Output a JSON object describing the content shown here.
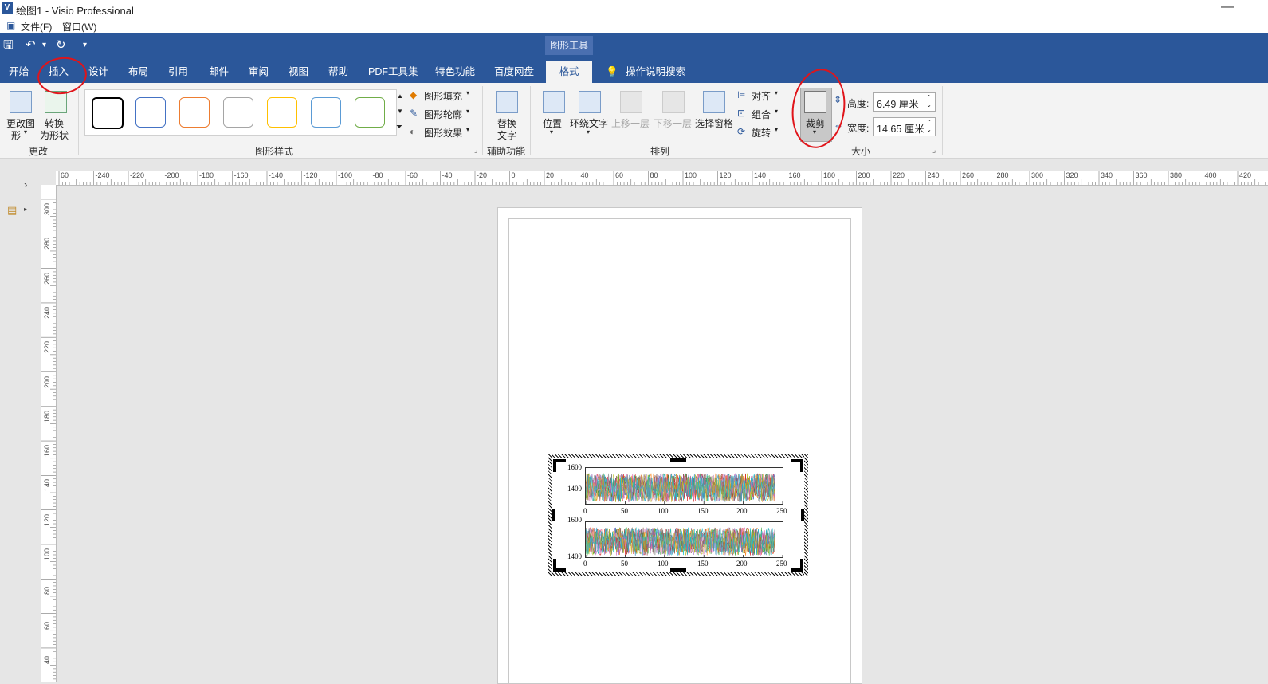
{
  "window": {
    "app_icon": "V",
    "title": "绘图1 - Visio Professional",
    "minimize": "—"
  },
  "menubar": {
    "file": "文件(F)",
    "window": "窗口(W)"
  },
  "ribbon": {
    "context_group": "图形工具",
    "tabs": [
      "开始",
      "插入",
      "设计",
      "布局",
      "引用",
      "邮件",
      "审阅",
      "视图",
      "帮助",
      "PDF工具集",
      "特色功能",
      "百度网盘"
    ],
    "active_tab": "格式",
    "tell_me": "操作说明搜索",
    "groups": {
      "change": {
        "label": "更改",
        "change_shape": "更改图",
        "change_shape2": "形",
        "convert": "转换",
        "convert2": "为形状"
      },
      "shape_styles": {
        "label": "图形样式",
        "fill": "图形填充",
        "outline": "图形轮廓",
        "effect": "图形效果"
      },
      "accessibility": {
        "label": "辅助功能",
        "alt_text": "替换",
        "alt_text2": "文字"
      },
      "arrange": {
        "label": "排列",
        "position": "位置",
        "wrap": "环绕文字",
        "bring_forward": "上移一层",
        "send_backward": "下移一层",
        "selection_pane": "选择窗格",
        "align": "对齐",
        "group": "组合",
        "rotate": "旋转"
      },
      "size": {
        "label": "大小",
        "crop": "裁剪",
        "height_label": "高度:",
        "height_value": "6.49 厘米",
        "width_label": "宽度:",
        "width_value": "14.65 厘米"
      }
    },
    "style_colors": [
      "#000000",
      "#4472c4",
      "#ed7d31",
      "#a5a5a5",
      "#ffc000",
      "#5b9bd5",
      "#70ad47"
    ]
  },
  "rulers": {
    "h_ticks": [
      "60",
      "-240",
      "-220",
      "-200",
      "-180",
      "-160",
      "-140",
      "-120",
      "-100",
      "-80",
      "-60",
      "-40",
      "-20",
      "0",
      "20",
      "40",
      "60",
      "80",
      "100",
      "120",
      "140",
      "160",
      "180",
      "200",
      "220",
      "240",
      "260",
      "280",
      "300",
      "320",
      "340",
      "360",
      "380",
      "400",
      "420"
    ],
    "v_ticks": [
      "300",
      "280",
      "260",
      "240",
      "220",
      "200",
      "180",
      "160",
      "140",
      "120",
      "100",
      "80",
      "60",
      "40"
    ]
  },
  "chart_data": [
    {
      "type": "line",
      "xlim": [
        0,
        250
      ],
      "ylim": [
        1300,
        1600
      ],
      "x_ticks": [
        "0",
        "50",
        "100",
        "150",
        "200",
        "250"
      ],
      "y_ticks": [
        "1600",
        "1400"
      ],
      "series_colors": [
        "#1f77b4",
        "#ff7f0e",
        "#2ca02c",
        "#d62728",
        "#9467bd",
        "#8c564b",
        "#e377c2",
        "#7f7f7f",
        "#bcbd22",
        "#17becf"
      ]
    },
    {
      "type": "line",
      "xlim": [
        0,
        250
      ],
      "ylim": [
        1400,
        1600
      ],
      "x_ticks": [
        "0",
        "50",
        "100",
        "150",
        "200",
        "250"
      ],
      "y_ticks": [
        "1600",
        "1400"
      ],
      "series_colors": [
        "#1f77b4",
        "#ff7f0e",
        "#2ca02c",
        "#d62728",
        "#9467bd",
        "#8c564b",
        "#e377c2",
        "#7f7f7f",
        "#bcbd22",
        "#17becf"
      ]
    }
  ]
}
